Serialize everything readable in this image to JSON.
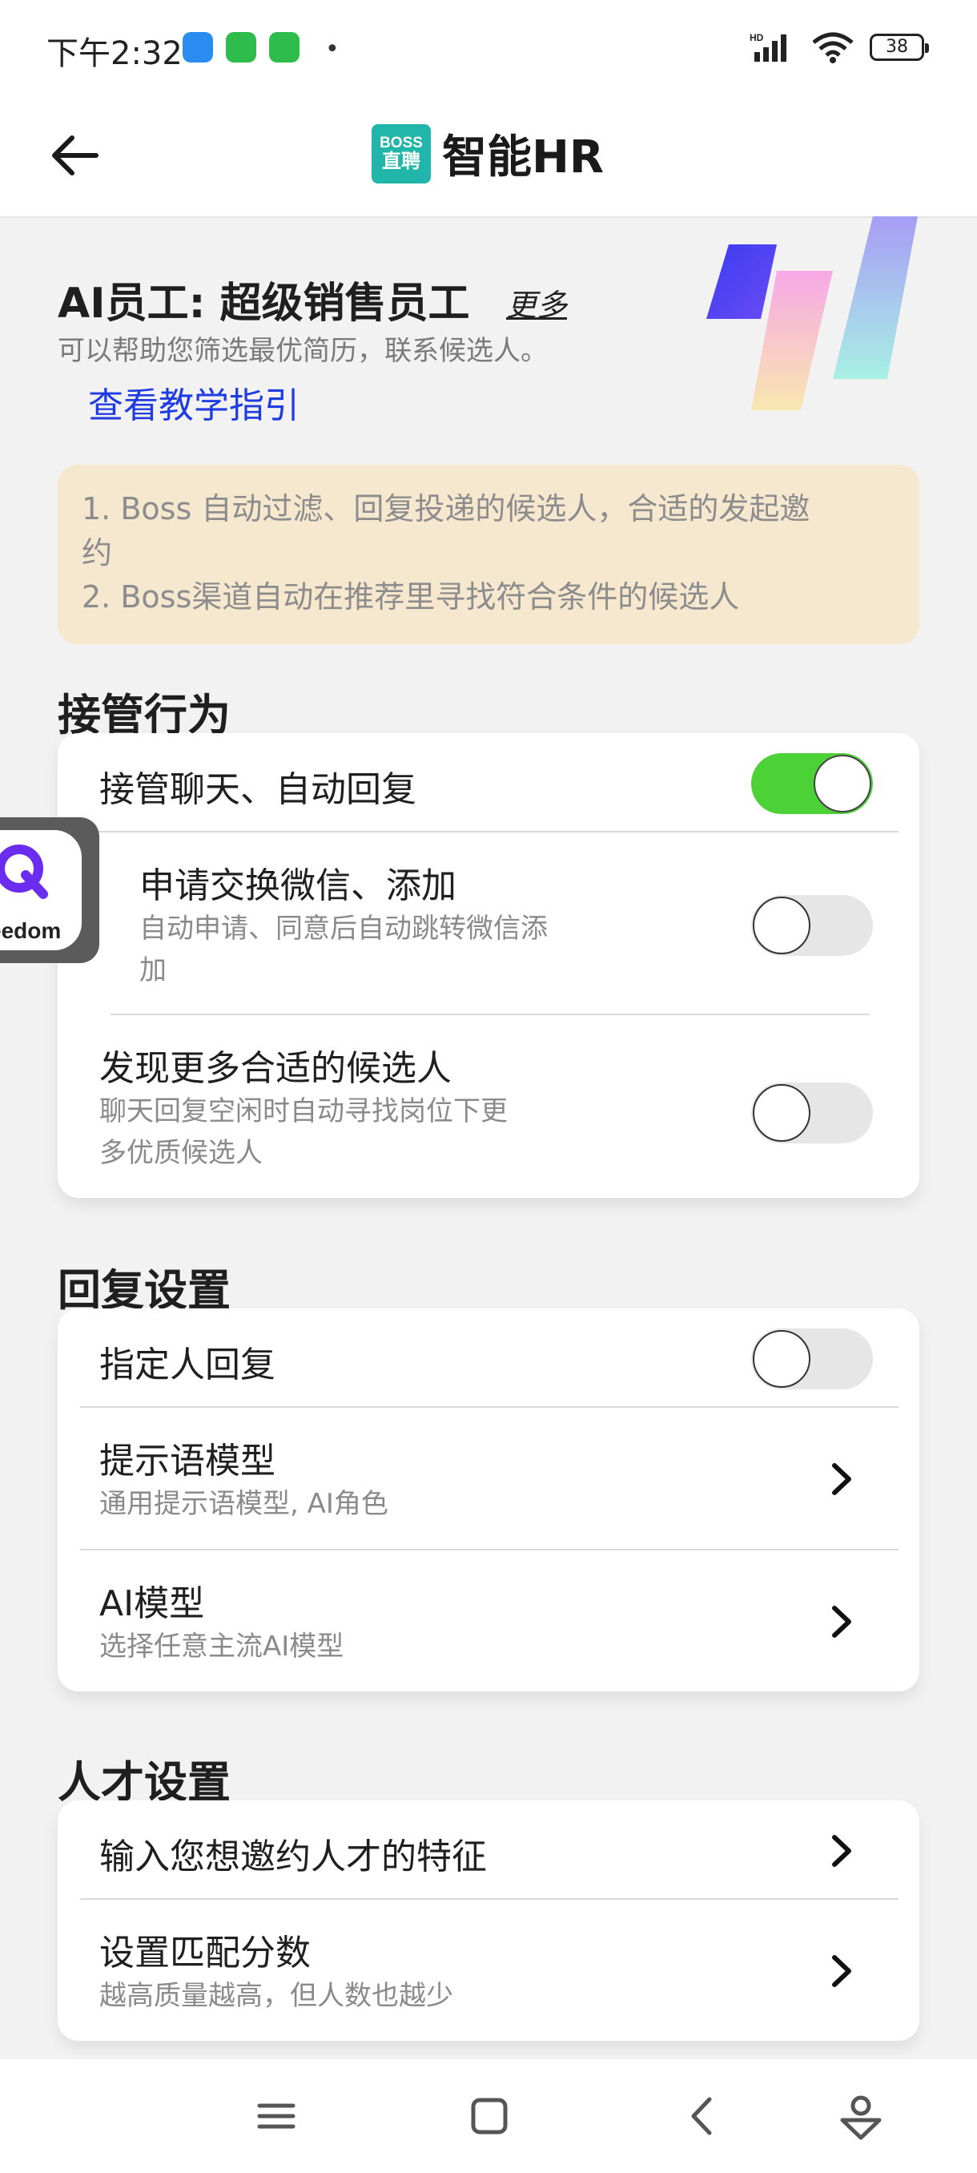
{
  "status_bar": {
    "time": "下午2:32",
    "battery": "38",
    "network": "HD"
  },
  "app_bar": {
    "logo_line1": "BOSS",
    "logo_line2": "直聘",
    "title": "智能HR"
  },
  "hero": {
    "title": "AI员工: 超级销售员工",
    "more": "更多",
    "subtitle": "可以帮助您筛选最优简历，联系候选人。",
    "guide_link": "查看教学指引"
  },
  "info": {
    "line1": "1. Boss 自动过滤、回复投递的候选人，合适的发起邀",
    "line1b": "约",
    "line2": "2. Boss渠道自动在推荐里寻找符合条件的候选人"
  },
  "section_takeover": {
    "title": "接管行为",
    "rows": [
      {
        "title": "接管聊天、自动回复",
        "on": true
      },
      {
        "title": "申请交换微信、添加",
        "sub1": "自动申请、同意后自动跳转微信添",
        "sub2": "加",
        "on": false
      },
      {
        "title": "发现更多合适的候选人",
        "sub1": "聊天回复空闲时自动寻找岗位下更",
        "sub2": "多优质候选人",
        "on": false
      }
    ]
  },
  "section_reply": {
    "title": "回复设置",
    "rows": [
      {
        "title": "指定人回复",
        "on": false
      },
      {
        "title": "提示语模型",
        "sub": "通用提示语模型, AI角色"
      },
      {
        "title": "AI模型",
        "sub": "选择任意主流AI模型"
      }
    ]
  },
  "section_talent": {
    "title": "人才设置",
    "rows": [
      {
        "title": "输入您想邀约人才的特征"
      },
      {
        "title": "设置匹配分数",
        "sub": "越高质量越高，但人数也越少"
      }
    ]
  },
  "float_widget": {
    "label": "eedom"
  },
  "colors": {
    "toggle_on": "#4cd137",
    "link_blue": "#1f3ce0",
    "info_bg": "#f6e7cf",
    "boss_teal": "#22b6aa"
  }
}
